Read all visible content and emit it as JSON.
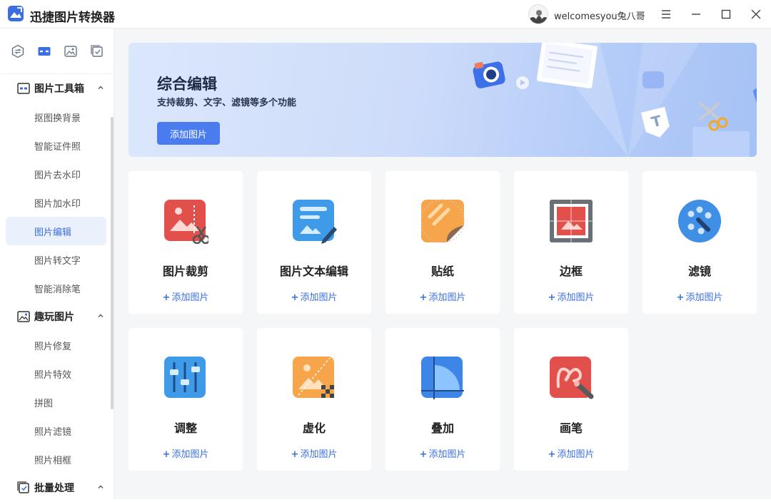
{
  "app": {
    "title": "迅捷图片转换器"
  },
  "user": {
    "name": "welcomesyou兔八哥"
  },
  "colors": {
    "accent": "#3b6fe0",
    "button": "#4a7cf0",
    "active_bg": "#eaf1fd"
  },
  "sidebar": {
    "tabs": [
      {
        "icon": "format-convert-icon"
      },
      {
        "icon": "toolbox-icon"
      },
      {
        "icon": "image-icon"
      },
      {
        "icon": "batch-check-icon"
      }
    ],
    "groups": [
      {
        "label": "图片工具箱",
        "icon": "toolbox-icon",
        "items": [
          "抠图换背景",
          "智能证件照",
          "图片去水印",
          "图片加水印",
          "图片编辑",
          "图片转文字",
          "智能消除笔"
        ]
      },
      {
        "label": "趣玩图片",
        "icon": "fun-image-icon",
        "items": [
          "照片修复",
          "照片特效",
          "拼图",
          "照片滤镜",
          "照片相框"
        ]
      },
      {
        "label": "批量处理",
        "icon": "batch-icon",
        "items": []
      }
    ],
    "active_item": "图片编辑"
  },
  "banner": {
    "title": "综合编辑",
    "subtitle": "支持裁剪、文字、滤镜等多个功能",
    "button": "添加图片"
  },
  "cards": [
    {
      "title": "图片裁剪",
      "add": "添加图片",
      "icon": "crop-icon"
    },
    {
      "title": "图片文本编辑",
      "add": "添加图片",
      "icon": "text-edit-icon"
    },
    {
      "title": "贴纸",
      "add": "添加图片",
      "icon": "sticker-icon"
    },
    {
      "title": "边框",
      "add": "添加图片",
      "icon": "frame-icon"
    },
    {
      "title": "滤镜",
      "add": "添加图片",
      "icon": "filter-icon"
    },
    {
      "title": "调整",
      "add": "添加图片",
      "icon": "adjust-icon"
    },
    {
      "title": "虚化",
      "add": "添加图片",
      "icon": "blur-icon"
    },
    {
      "title": "叠加",
      "add": "添加图片",
      "icon": "overlay-icon"
    },
    {
      "title": "画笔",
      "add": "添加图片",
      "icon": "brush-icon"
    }
  ]
}
